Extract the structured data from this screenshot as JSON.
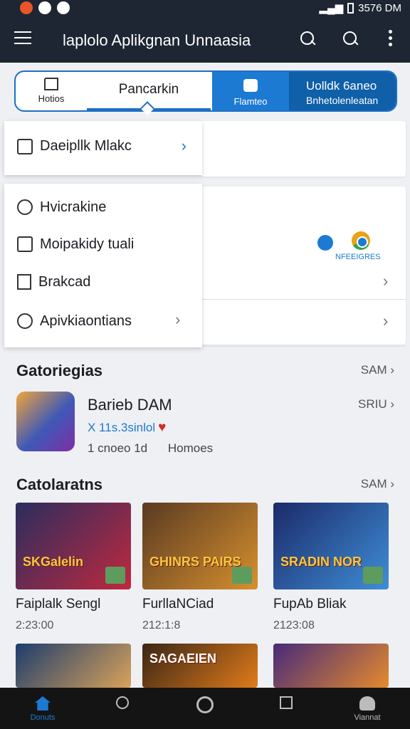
{
  "status_bar": {
    "time": "3576 DM"
  },
  "app_bar": {
    "title": "laplolo Aplikgnan Unnaasia"
  },
  "tabs": {
    "home_label": "Hotios",
    "active_label": "Pancarkin",
    "games_label": "Flamteo",
    "promo_title": "Uolldk 6aneo",
    "promo_sub": "Bnhetolenleatan"
  },
  "background": {
    "label": "NFEEIGRES"
  },
  "dropdown": {
    "top_item": "Daeipllk Mlakc",
    "items": [
      "Hvicrakine",
      "Moipakidy tuali",
      "Brakcad",
      "Apivkiaontians"
    ]
  },
  "sections": {
    "categories_title": "Gatoriegias",
    "categories_see_all": "SAM",
    "featured": {
      "name": "Barieb DAM",
      "see_all": "SRIU",
      "rating": "X 11s.3sinlol",
      "sub_left": "1 cnoeo 1d",
      "sub_right": "Homoes"
    },
    "catalog_title": "Catolaratns",
    "catalog_see_all": "SAM"
  },
  "games": [
    {
      "name": "Faiplalk Sengl",
      "size": "2:23:00",
      "art": "SKGalelin",
      "colors": [
        "#2a2d5e",
        "#c0283f"
      ]
    },
    {
      "name": "FurllaNCiad",
      "size": "212:1:8",
      "art": "GHINRS PAIRS",
      "colors": [
        "#5a3a22",
        "#d6902e"
      ]
    },
    {
      "name": "FupAb Bliak",
      "size": "2123:08",
      "art": "SRADIN NOR",
      "colors": [
        "#1b2a6a",
        "#3f8ed6"
      ]
    }
  ],
  "games_row2": [
    {
      "art": "",
      "colors": [
        "#1e3d6d",
        "#d9a25a"
      ]
    },
    {
      "art": "SAGAEIEN",
      "colors": [
        "#3a2614",
        "#e07b1b"
      ]
    },
    {
      "art": "",
      "colors": [
        "#472a7a",
        "#e58a2c"
      ]
    }
  ],
  "bottom_nav": {
    "home_label": "Donuts",
    "profile_label": "Viannat"
  },
  "colors": {
    "accent": "#1c7ad2",
    "app_bar": "#1d2632",
    "nav": "#141414"
  }
}
